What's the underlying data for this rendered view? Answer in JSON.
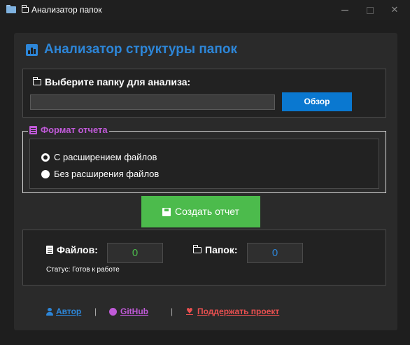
{
  "window": {
    "title": "Анализатор папок",
    "title_prefix_icon": "folder-icon",
    "app_icon": "folder-app-icon",
    "close_glyph": "✕"
  },
  "header": {
    "title": "Анализатор структуры папок",
    "icon": "chart-icon",
    "color": "#2d86d8"
  },
  "folder_select": {
    "label": "Выберите папку для анализа:",
    "path_value": "",
    "browse_label": "Обзор",
    "browse_color": "#0a78d0"
  },
  "format": {
    "legend": "Формат отчета",
    "legend_color": "#c05ad8",
    "options": [
      {
        "label": "С расширением файлов",
        "selected": true
      },
      {
        "label": "Без расширения файлов",
        "selected": false
      }
    ]
  },
  "create_button": {
    "label": "Создать отчет",
    "icon": "save-icon",
    "color": "#4cbb4c"
  },
  "stats": {
    "files_label": "Файлов:",
    "files_value": "0",
    "folders_label": "Папок:",
    "folders_value": "0",
    "status": "Статус: Готов к работе"
  },
  "footer": {
    "author": "Автор",
    "github": "GitHub",
    "support": "Поддержать проект",
    "separator": "|"
  }
}
